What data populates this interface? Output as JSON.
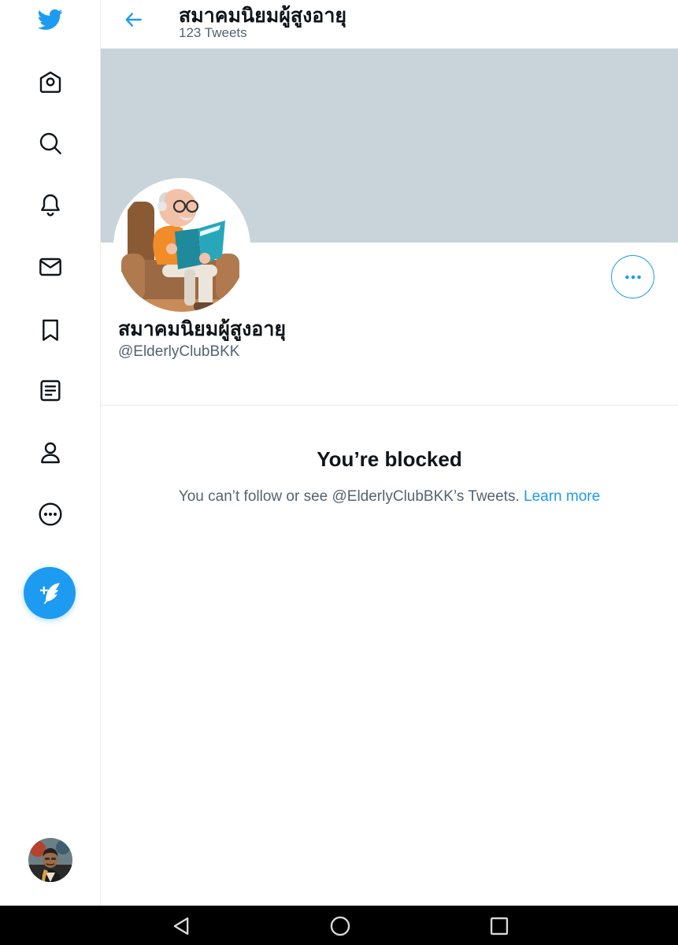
{
  "sidebar": {
    "logo_icon": "twitter-bird-icon",
    "items": [
      {
        "name": "home",
        "icon": "home-icon"
      },
      {
        "name": "explore",
        "icon": "search-icon"
      },
      {
        "name": "notifications",
        "icon": "bell-icon"
      },
      {
        "name": "messages",
        "icon": "mail-icon"
      },
      {
        "name": "bookmarks",
        "icon": "bookmark-icon"
      },
      {
        "name": "lists",
        "icon": "list-icon"
      },
      {
        "name": "profile",
        "icon": "person-icon"
      },
      {
        "name": "more",
        "icon": "more-circle-icon"
      }
    ],
    "compose_icon": "compose-tweet-icon"
  },
  "header": {
    "title": "สมาคมนิยมผู้สูงอายุ",
    "subtitle": "123 Tweets"
  },
  "profile": {
    "name": "สมาคมนิยมผู้สูงอายุ",
    "handle": "@ElderlyClubBKK"
  },
  "blocked": {
    "title": "You’re blocked",
    "message": "You can’t follow or see @ElderlyClubBKK’s Tweets.",
    "link": "Learn more"
  },
  "colors": {
    "accent": "#1d9bf0",
    "banner": "#c8d3da",
    "text_primary": "#0f1419",
    "text_secondary": "#536471"
  }
}
